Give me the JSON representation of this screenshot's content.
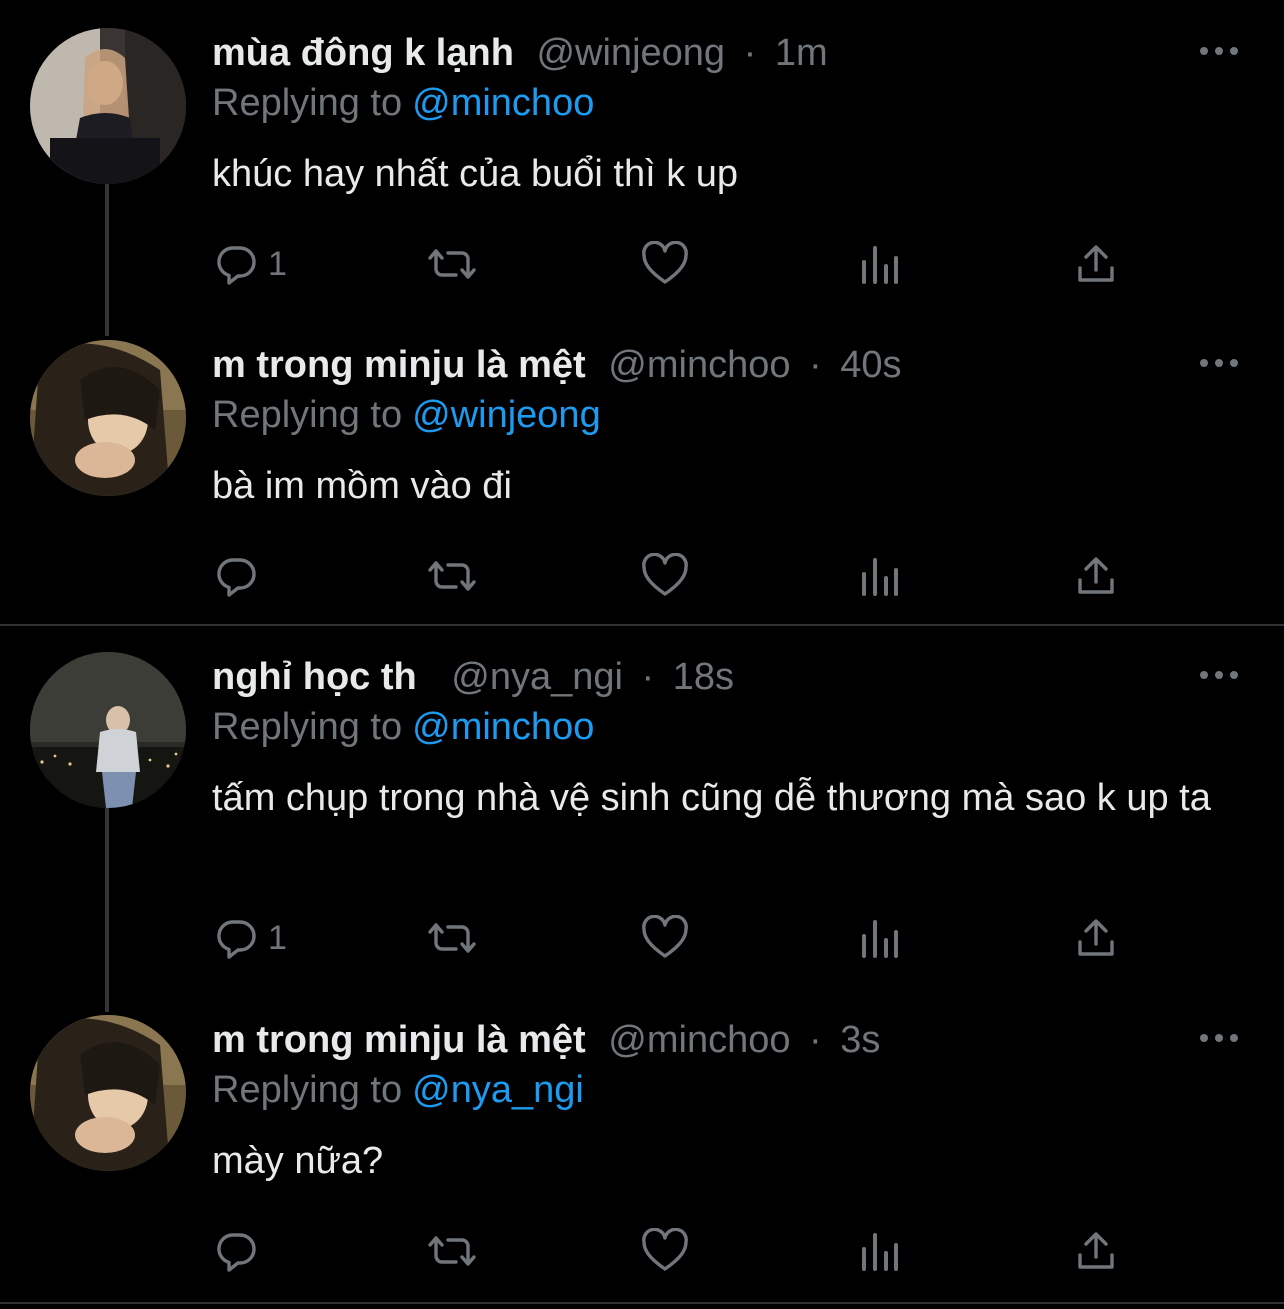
{
  "colors": {
    "background": "#000000",
    "primary_text": "#e7e9ea",
    "secondary_text": "#71767b",
    "link": "#1d9bf0",
    "divider": "#2f3336"
  },
  "tweets": [
    {
      "display_name": "mùa đông k lạnh",
      "handle": "@winjeong",
      "separator": "·",
      "time": "1m",
      "replying_label": "Replying to",
      "replying_to": "@minchoo",
      "text": "khúc hay nhất của buổi thì k up",
      "reply_count": "1",
      "icons": [
        "reply-icon",
        "retweet-icon",
        "like-icon",
        "analytics-icon",
        "share-icon",
        "more-icon"
      ]
    },
    {
      "display_name": "m trong minju là mệt",
      "handle": "@minchoo",
      "separator": "·",
      "time": "40s",
      "replying_label": "Replying to",
      "replying_to": "@winjeong",
      "text": "bà im mồm vào đi",
      "reply_count": "",
      "icons": [
        "reply-icon",
        "retweet-icon",
        "like-icon",
        "analytics-icon",
        "share-icon",
        "more-icon"
      ]
    },
    {
      "display_name": "nghỉ học th",
      "handle": "@nya_ngi",
      "separator": "·",
      "time": "18s",
      "replying_label": "Replying to",
      "replying_to": "@minchoo",
      "text": "tấm chụp trong nhà vệ sinh cũng dễ thương mà sao k up ta",
      "reply_count": "1",
      "icons": [
        "reply-icon",
        "retweet-icon",
        "like-icon",
        "analytics-icon",
        "share-icon",
        "more-icon"
      ]
    },
    {
      "display_name": "m trong minju là mệt",
      "handle": "@minchoo",
      "separator": "·",
      "time": "3s",
      "replying_label": "Replying to",
      "replying_to": "@nya_ngi",
      "text": "mày nữa?",
      "reply_count": "",
      "icons": [
        "reply-icon",
        "retweet-icon",
        "like-icon",
        "analytics-icon",
        "share-icon",
        "more-icon"
      ]
    }
  ]
}
